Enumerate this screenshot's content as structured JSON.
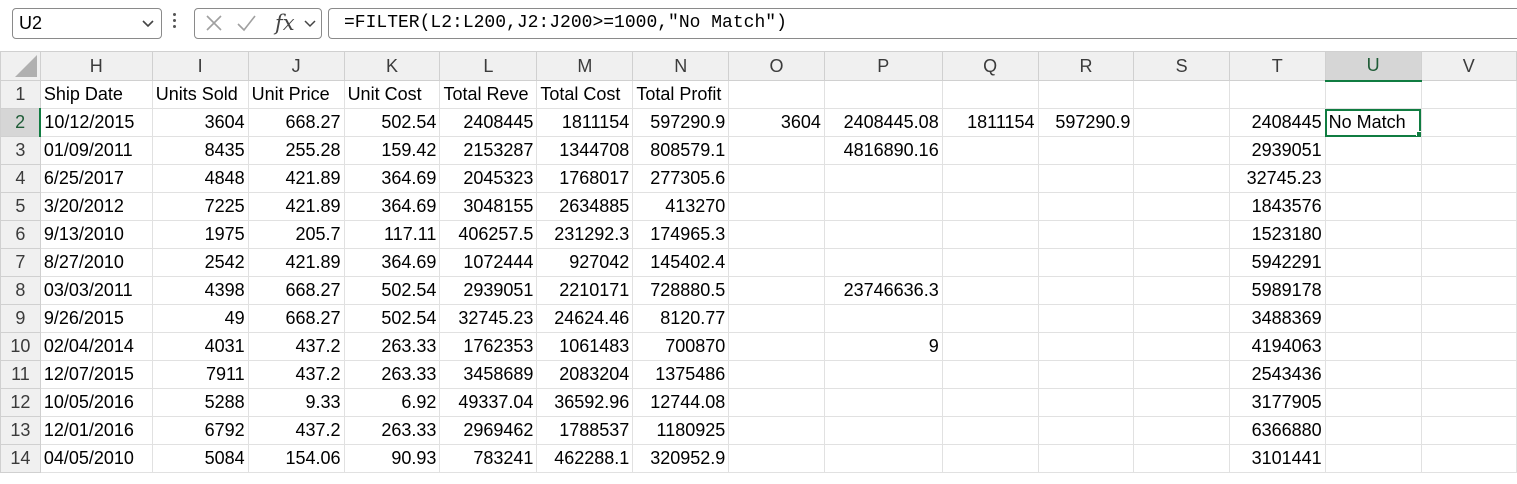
{
  "name_box": "U2",
  "formula": "=FILTER(L2:L200,J2:J200>=1000,\"No Match\")",
  "columns": [
    "H",
    "I",
    "J",
    "K",
    "L",
    "M",
    "N",
    "O",
    "P",
    "Q",
    "R",
    "S",
    "T",
    "U",
    "V"
  ],
  "selected_column": "U",
  "selected_row": "2",
  "rows": [
    {
      "num": "1",
      "cells": [
        "Ship Date",
        "Units Sold",
        "Unit Price",
        "Unit Cost",
        "Total Reve",
        "Total Cost",
        "Total Profit",
        "",
        "",
        "",
        "",
        "",
        "",
        "",
        ""
      ]
    },
    {
      "num": "2",
      "cells": [
        "10/12/2015",
        "3604",
        "668.27",
        "502.54",
        "2408445",
        "1811154",
        "597290.9",
        "3604",
        "2408445.08",
        "1811154",
        "597290.9",
        "",
        "2408445",
        "No Match",
        ""
      ]
    },
    {
      "num": "3",
      "cells": [
        "01/09/2011",
        "8435",
        "255.28",
        "159.42",
        "2153287",
        "1344708",
        "808579.1",
        "",
        "4816890.16",
        "",
        "",
        "",
        "2939051",
        "",
        ""
      ]
    },
    {
      "num": "4",
      "cells": [
        "6/25/2017",
        "4848",
        "421.89",
        "364.69",
        "2045323",
        "1768017",
        "277305.6",
        "",
        "",
        "",
        "",
        "",
        "32745.23",
        "",
        ""
      ]
    },
    {
      "num": "5",
      "cells": [
        "3/20/2012",
        "7225",
        "421.89",
        "364.69",
        "3048155",
        "2634885",
        "413270",
        "",
        "",
        "",
        "",
        "",
        "1843576",
        "",
        ""
      ]
    },
    {
      "num": "6",
      "cells": [
        "9/13/2010",
        "1975",
        "205.7",
        "117.11",
        "406257.5",
        "231292.3",
        "174965.3",
        "",
        "",
        "",
        "",
        "",
        "1523180",
        "",
        ""
      ]
    },
    {
      "num": "7",
      "cells": [
        "8/27/2010",
        "2542",
        "421.89",
        "364.69",
        "1072444",
        "927042",
        "145402.4",
        "",
        "",
        "",
        "",
        "",
        "5942291",
        "",
        ""
      ]
    },
    {
      "num": "8",
      "cells": [
        "03/03/2011",
        "4398",
        "668.27",
        "502.54",
        "2939051",
        "2210171",
        "728880.5",
        "",
        "23746636.3",
        "",
        "",
        "",
        "5989178",
        "",
        ""
      ]
    },
    {
      "num": "9",
      "cells": [
        "9/26/2015",
        "49",
        "668.27",
        "502.54",
        "32745.23",
        "24624.46",
        "8120.77",
        "",
        "",
        "",
        "",
        "",
        "3488369",
        "",
        ""
      ]
    },
    {
      "num": "10",
      "cells": [
        "02/04/2014",
        "4031",
        "437.2",
        "263.33",
        "1762353",
        "1061483",
        "700870",
        "",
        "9",
        "",
        "",
        "",
        "4194063",
        "",
        ""
      ]
    },
    {
      "num": "11",
      "cells": [
        "12/07/2015",
        "7911",
        "437.2",
        "263.33",
        "3458689",
        "2083204",
        "1375486",
        "",
        "",
        "",
        "",
        "",
        "2543436",
        "",
        ""
      ]
    },
    {
      "num": "12",
      "cells": [
        "10/05/2016",
        "5288",
        "9.33",
        "6.92",
        "49337.04",
        "36592.96",
        "12744.08",
        "",
        "",
        "",
        "",
        "",
        "3177905",
        "",
        ""
      ]
    },
    {
      "num": "13",
      "cells": [
        "12/01/2016",
        "6792",
        "437.2",
        "263.33",
        "2969462",
        "1788537",
        "1180925",
        "",
        "",
        "",
        "",
        "",
        "6366880",
        "",
        ""
      ]
    },
    {
      "num": "14",
      "cells": [
        "04/05/2010",
        "5084",
        "154.06",
        "90.93",
        "783241",
        "462288.1",
        "320952.9",
        "",
        "",
        "",
        "",
        "",
        "3101441",
        "",
        ""
      ]
    }
  ],
  "accent_color": "#107c41",
  "icons": {
    "cancel": "x-icon",
    "enter": "check-icon",
    "function": "fx-icon",
    "namebox_dropdown": "chevron-down-icon"
  }
}
